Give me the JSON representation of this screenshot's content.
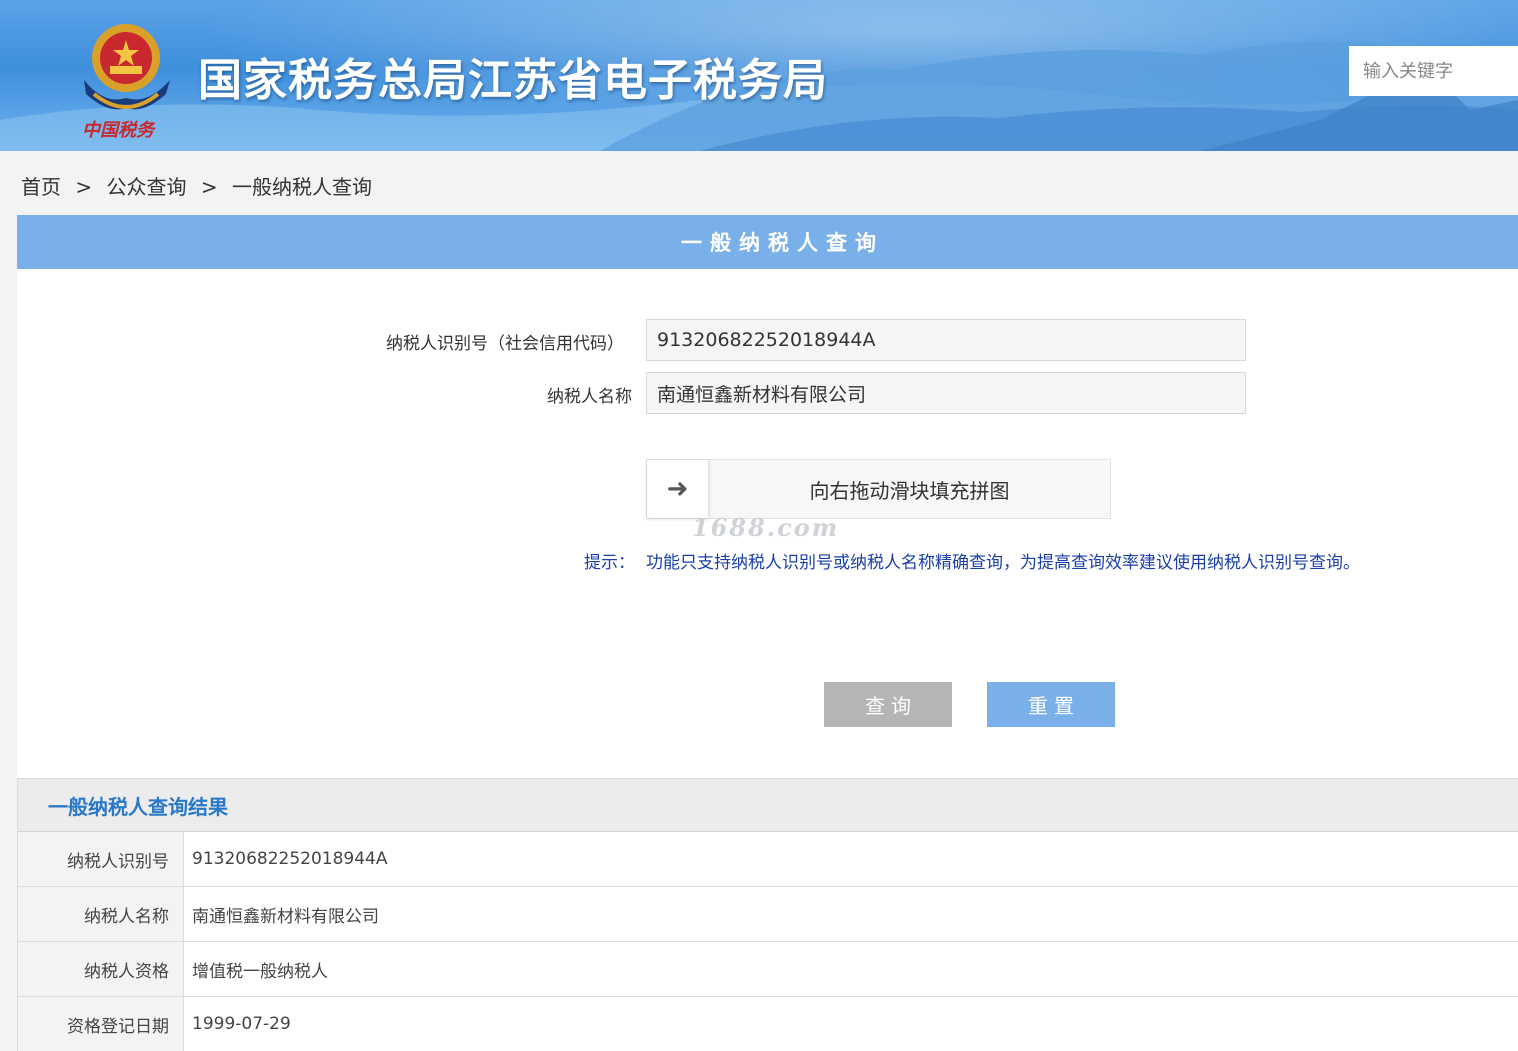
{
  "header": {
    "title": "国家税务总局江苏省电子税务局",
    "emblem_caption": "中国税务",
    "search_placeholder": "输入关键字"
  },
  "breadcrumb": {
    "items": [
      "首页",
      "公众查询",
      "一般纳税人查询"
    ],
    "separator": ">"
  },
  "query_panel": {
    "title": "一般纳税人查询",
    "taxpayer_id_label": "纳税人识别号（社会信用代码）",
    "taxpayer_id_value": "91320682252018944A",
    "taxpayer_name_label": "纳税人名称",
    "taxpayer_name_value": "南通恒鑫新材料有限公司",
    "slider_text": "向右拖动滑块填充拼图",
    "slider_handle_icon": "arrow-right-icon",
    "watermark": "1688.com",
    "hint_label": "提示：",
    "hint_text": "功能只支持纳税人识别号或纳税人名称精确查询，为提高查询效率建议使用纳税人识别号查询。",
    "query_button": "查询",
    "reset_button": "重置"
  },
  "results": {
    "title": "一般纳税人查询结果",
    "rows": [
      {
        "label": "纳税人识别号",
        "value": "91320682252018944A"
      },
      {
        "label": "纳税人名称",
        "value": "南通恒鑫新材料有限公司"
      },
      {
        "label": "纳税人资格",
        "value": "增值税一般纳税人"
      },
      {
        "label": "资格登记日期",
        "value": "1999-07-29"
      }
    ]
  },
  "colors": {
    "banner": "#3f8fdc",
    "panel_header": "#7ab0e9",
    "hint": "#1a3fa8",
    "result_title": "#2a78c8",
    "query_button": "#b5b5b5",
    "reset_button": "#7ab0e9"
  }
}
